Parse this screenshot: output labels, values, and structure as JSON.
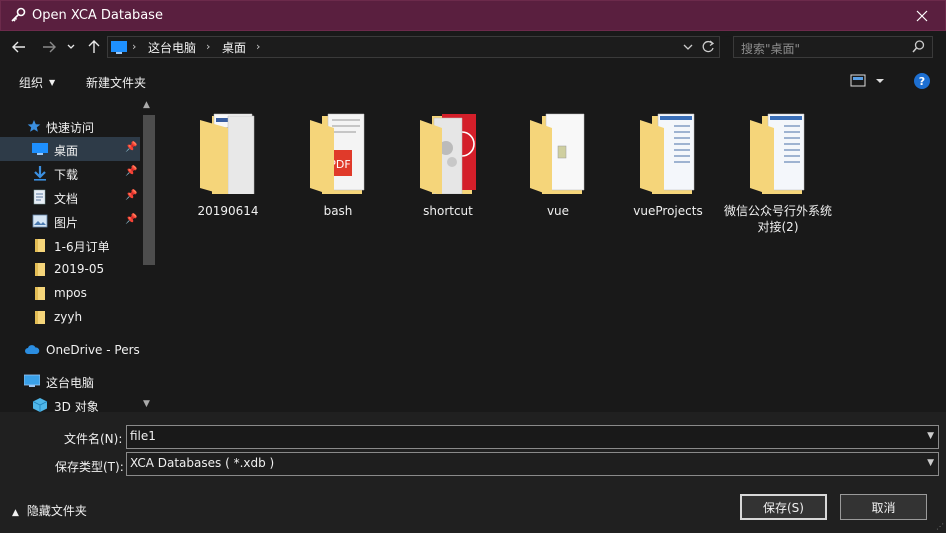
{
  "window": {
    "title": "Open XCA Database",
    "close_icon": "close-icon"
  },
  "nav": {
    "breadcrumbs": [
      "这台电脑",
      "桌面"
    ],
    "search_placeholder": "搜索\"桌面\""
  },
  "toolbar": {
    "organize_label": "组织",
    "new_folder_label": "新建文件夹",
    "help_label": "?"
  },
  "sidebar": {
    "quick_access": "快速访问",
    "items": [
      {
        "label": "桌面",
        "icon": "desktop-icon",
        "pinned": true
      },
      {
        "label": "下载",
        "icon": "download-icon",
        "pinned": true
      },
      {
        "label": "文档",
        "icon": "document-icon",
        "pinned": true
      },
      {
        "label": "图片",
        "icon": "picture-icon",
        "pinned": true
      },
      {
        "label": "1-6月订单",
        "icon": "folder-icon",
        "pinned": false
      },
      {
        "label": "2019-05",
        "icon": "folder-icon",
        "pinned": false
      },
      {
        "label": "mpos",
        "icon": "folder-icon",
        "pinned": false
      },
      {
        "label": "zyyh",
        "icon": "folder-icon",
        "pinned": false
      }
    ],
    "onedrive": "OneDrive - Perso",
    "this_pc": "这台电脑",
    "objects_3d": "3D 对象"
  },
  "files": [
    {
      "name": "20190614",
      "kind": "documents"
    },
    {
      "name": "bash",
      "kind": "pdf"
    },
    {
      "name": "shortcut",
      "kind": "red"
    },
    {
      "name": "vue",
      "kind": "plain"
    },
    {
      "name": "vueProjects",
      "kind": "docs-blue"
    },
    {
      "name": "微信公众号行外系统对接(2)",
      "kind": "docs-blue"
    }
  ],
  "footer": {
    "filename_label": "文件名(N):",
    "filename_value": "file1",
    "filetype_label": "保存类型(T):",
    "filetype_value": "XCA Databases ( *.xdb )",
    "hide_folders_label": "隐藏文件夹",
    "save_label": "保存(S)",
    "cancel_label": "取消"
  },
  "colors": {
    "titlebar": "#5a1f3f",
    "background": "#191919",
    "selected": "#2e3b48",
    "folder": "#f5d57a",
    "accent": "#1d6fd1"
  }
}
